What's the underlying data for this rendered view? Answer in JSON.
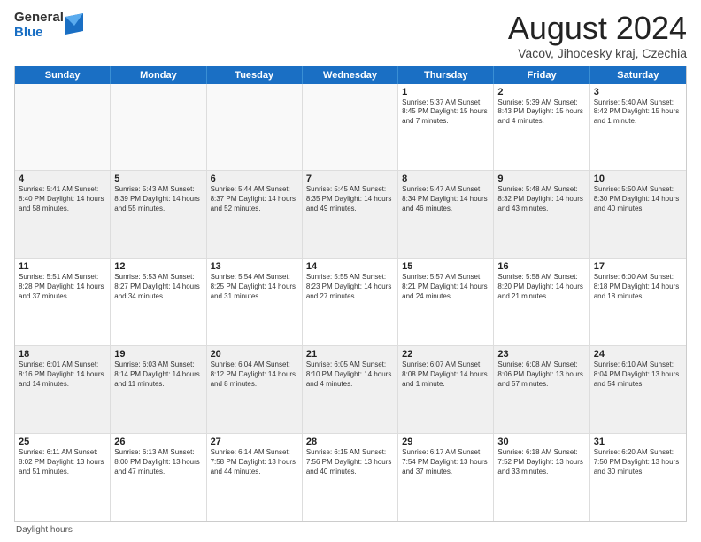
{
  "logo": {
    "general": "General",
    "blue": "Blue"
  },
  "title": "August 2024",
  "subtitle": "Vacov, Jihocesky kraj, Czechia",
  "days_of_week": [
    "Sunday",
    "Monday",
    "Tuesday",
    "Wednesday",
    "Thursday",
    "Friday",
    "Saturday"
  ],
  "footer": "Daylight hours",
  "weeks": [
    [
      {
        "day": "",
        "info": "",
        "empty": true
      },
      {
        "day": "",
        "info": "",
        "empty": true
      },
      {
        "day": "",
        "info": "",
        "empty": true
      },
      {
        "day": "",
        "info": "",
        "empty": true
      },
      {
        "day": "1",
        "info": "Sunrise: 5:37 AM\nSunset: 8:45 PM\nDaylight: 15 hours\nand 7 minutes.",
        "empty": false
      },
      {
        "day": "2",
        "info": "Sunrise: 5:39 AM\nSunset: 8:43 PM\nDaylight: 15 hours\nand 4 minutes.",
        "empty": false
      },
      {
        "day": "3",
        "info": "Sunrise: 5:40 AM\nSunset: 8:42 PM\nDaylight: 15 hours\nand 1 minute.",
        "empty": false
      }
    ],
    [
      {
        "day": "4",
        "info": "Sunrise: 5:41 AM\nSunset: 8:40 PM\nDaylight: 14 hours\nand 58 minutes.",
        "empty": false,
        "shaded": true
      },
      {
        "day": "5",
        "info": "Sunrise: 5:43 AM\nSunset: 8:39 PM\nDaylight: 14 hours\nand 55 minutes.",
        "empty": false,
        "shaded": true
      },
      {
        "day": "6",
        "info": "Sunrise: 5:44 AM\nSunset: 8:37 PM\nDaylight: 14 hours\nand 52 minutes.",
        "empty": false,
        "shaded": true
      },
      {
        "day": "7",
        "info": "Sunrise: 5:45 AM\nSunset: 8:35 PM\nDaylight: 14 hours\nand 49 minutes.",
        "empty": false,
        "shaded": true
      },
      {
        "day": "8",
        "info": "Sunrise: 5:47 AM\nSunset: 8:34 PM\nDaylight: 14 hours\nand 46 minutes.",
        "empty": false,
        "shaded": true
      },
      {
        "day": "9",
        "info": "Sunrise: 5:48 AM\nSunset: 8:32 PM\nDaylight: 14 hours\nand 43 minutes.",
        "empty": false,
        "shaded": true
      },
      {
        "day": "10",
        "info": "Sunrise: 5:50 AM\nSunset: 8:30 PM\nDaylight: 14 hours\nand 40 minutes.",
        "empty": false,
        "shaded": true
      }
    ],
    [
      {
        "day": "11",
        "info": "Sunrise: 5:51 AM\nSunset: 8:28 PM\nDaylight: 14 hours\nand 37 minutes.",
        "empty": false
      },
      {
        "day": "12",
        "info": "Sunrise: 5:53 AM\nSunset: 8:27 PM\nDaylight: 14 hours\nand 34 minutes.",
        "empty": false
      },
      {
        "day": "13",
        "info": "Sunrise: 5:54 AM\nSunset: 8:25 PM\nDaylight: 14 hours\nand 31 minutes.",
        "empty": false
      },
      {
        "day": "14",
        "info": "Sunrise: 5:55 AM\nSunset: 8:23 PM\nDaylight: 14 hours\nand 27 minutes.",
        "empty": false
      },
      {
        "day": "15",
        "info": "Sunrise: 5:57 AM\nSunset: 8:21 PM\nDaylight: 14 hours\nand 24 minutes.",
        "empty": false
      },
      {
        "day": "16",
        "info": "Sunrise: 5:58 AM\nSunset: 8:20 PM\nDaylight: 14 hours\nand 21 minutes.",
        "empty": false
      },
      {
        "day": "17",
        "info": "Sunrise: 6:00 AM\nSunset: 8:18 PM\nDaylight: 14 hours\nand 18 minutes.",
        "empty": false
      }
    ],
    [
      {
        "day": "18",
        "info": "Sunrise: 6:01 AM\nSunset: 8:16 PM\nDaylight: 14 hours\nand 14 minutes.",
        "empty": false,
        "shaded": true
      },
      {
        "day": "19",
        "info": "Sunrise: 6:03 AM\nSunset: 8:14 PM\nDaylight: 14 hours\nand 11 minutes.",
        "empty": false,
        "shaded": true
      },
      {
        "day": "20",
        "info": "Sunrise: 6:04 AM\nSunset: 8:12 PM\nDaylight: 14 hours\nand 8 minutes.",
        "empty": false,
        "shaded": true
      },
      {
        "day": "21",
        "info": "Sunrise: 6:05 AM\nSunset: 8:10 PM\nDaylight: 14 hours\nand 4 minutes.",
        "empty": false,
        "shaded": true
      },
      {
        "day": "22",
        "info": "Sunrise: 6:07 AM\nSunset: 8:08 PM\nDaylight: 14 hours\nand 1 minute.",
        "empty": false,
        "shaded": true
      },
      {
        "day": "23",
        "info": "Sunrise: 6:08 AM\nSunset: 8:06 PM\nDaylight: 13 hours\nand 57 minutes.",
        "empty": false,
        "shaded": true
      },
      {
        "day": "24",
        "info": "Sunrise: 6:10 AM\nSunset: 8:04 PM\nDaylight: 13 hours\nand 54 minutes.",
        "empty": false,
        "shaded": true
      }
    ],
    [
      {
        "day": "25",
        "info": "Sunrise: 6:11 AM\nSunset: 8:02 PM\nDaylight: 13 hours\nand 51 minutes.",
        "empty": false
      },
      {
        "day": "26",
        "info": "Sunrise: 6:13 AM\nSunset: 8:00 PM\nDaylight: 13 hours\nand 47 minutes.",
        "empty": false
      },
      {
        "day": "27",
        "info": "Sunrise: 6:14 AM\nSunset: 7:58 PM\nDaylight: 13 hours\nand 44 minutes.",
        "empty": false
      },
      {
        "day": "28",
        "info": "Sunrise: 6:15 AM\nSunset: 7:56 PM\nDaylight: 13 hours\nand 40 minutes.",
        "empty": false
      },
      {
        "day": "29",
        "info": "Sunrise: 6:17 AM\nSunset: 7:54 PM\nDaylight: 13 hours\nand 37 minutes.",
        "empty": false
      },
      {
        "day": "30",
        "info": "Sunrise: 6:18 AM\nSunset: 7:52 PM\nDaylight: 13 hours\nand 33 minutes.",
        "empty": false
      },
      {
        "day": "31",
        "info": "Sunrise: 6:20 AM\nSunset: 7:50 PM\nDaylight: 13 hours\nand 30 minutes.",
        "empty": false
      }
    ]
  ]
}
